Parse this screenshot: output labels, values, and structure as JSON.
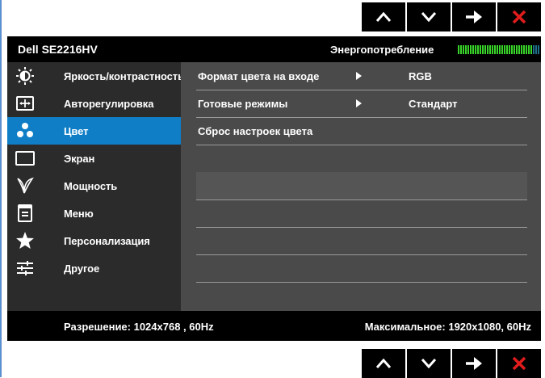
{
  "nav_buttons": [
    {
      "icon": "chevron-up-icon"
    },
    {
      "icon": "chevron-down-icon"
    },
    {
      "icon": "arrow-right-icon"
    },
    {
      "icon": "close-icon",
      "color": "#e01c1c"
    }
  ],
  "header": {
    "model": "Dell SE2216HV",
    "energy_label": "Энергопотребление",
    "energy_meter_level": 0.9,
    "energy_colors": {
      "on": "#39d42a",
      "off": "#1f6e8a"
    }
  },
  "menu": {
    "active_index": 2,
    "active_color": "#0f7ec6",
    "items": [
      {
        "label": "Яркость/контрастность",
        "icon": "brightness-icon"
      },
      {
        "label": "Авторегулировка",
        "icon": "auto-adjust-icon"
      },
      {
        "label": "Цвет",
        "icon": "color-dots-icon"
      },
      {
        "label": "Экран",
        "icon": "display-icon"
      },
      {
        "label": "Мощность",
        "icon": "power-leaf-icon"
      },
      {
        "label": "Меню",
        "icon": "menu-doc-icon"
      },
      {
        "label": "Персонализация",
        "icon": "star-icon"
      },
      {
        "label": "Другое",
        "icon": "sliders-icon"
      }
    ]
  },
  "submenu": {
    "rows": [
      {
        "label": "Формат цвета на входе",
        "value": "RGB"
      },
      {
        "label": "Готовые режимы",
        "value": "Стандарт"
      },
      {
        "label": "Сброс настроек цвета",
        "value": ""
      }
    ]
  },
  "footer": {
    "resolution": "Разрешение: 1024x768 , 60Hz",
    "max_resolution": "Максимальное: 1920x1080, 60Hz"
  }
}
